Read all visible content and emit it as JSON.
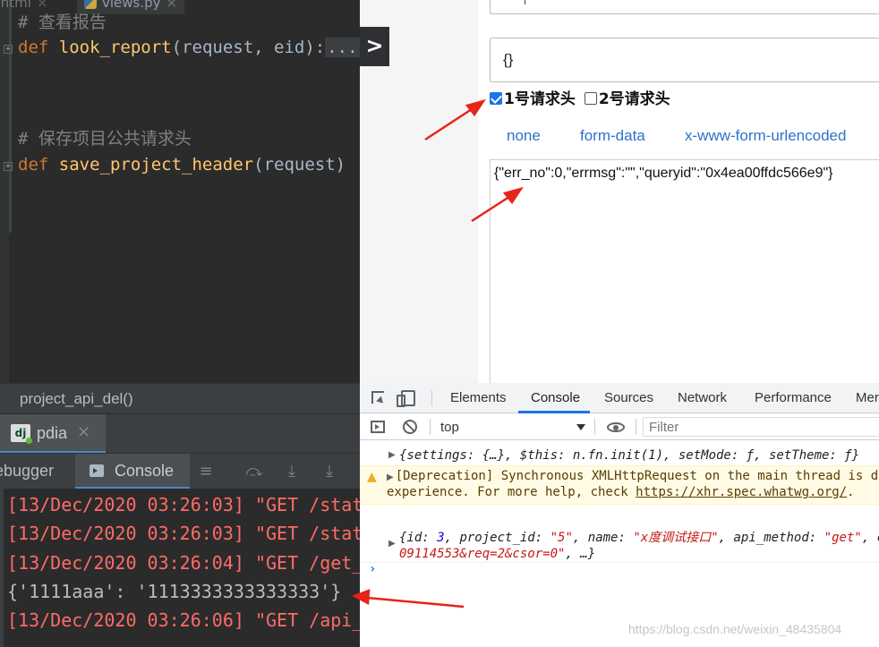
{
  "ide": {
    "tabs": [
      {
        "label": ".html",
        "close": "×"
      },
      {
        "label": "views.py",
        "close": "×"
      }
    ],
    "code": {
      "comment1": "# 查看报告",
      "kw": "def",
      "fn1": "look_report",
      "args1": "(request, eid):",
      "fold": "...",
      "comment2": "# 保存项目公共请求头",
      "fn2": "save_project_header",
      "args2": "(request)"
    },
    "breadcrumb": "project_api_del()",
    "run_tab": {
      "icon_text": "dj",
      "label": "pdia",
      "close": "×"
    },
    "tool_tabs": {
      "debugger": "ebugger",
      "console": "Console"
    },
    "console_lines": [
      {
        "text": "[13/Dec/2020 03:26:03] \"GET /stat",
        "kind": "err"
      },
      {
        "text": "[13/Dec/2020 03:26:03] \"GET /stat",
        "kind": "err"
      },
      {
        "text": "[13/Dec/2020 03:26:04] \"GET /get_",
        "kind": "err"
      },
      {
        "text": "{'1111aaa': '1113333333333333'}",
        "kind": "plain"
      },
      {
        "text": "[13/Dec/2020 03:26:06] \"GET /api_",
        "kind": "err"
      }
    ]
  },
  "page": {
    "next_button": ">",
    "body_value": "{}",
    "checkbox1": {
      "label": "1号请求头",
      "checked": true
    },
    "checkbox2": {
      "label": "2号请求头",
      "checked": false
    },
    "body_types": [
      "none",
      "form-data",
      "x-www-form-urlencoded"
    ],
    "response": "{\"err_no\":0,\"errmsg\":\"\",\"queryid\":\"0x4ea00ffdc566e9\"}"
  },
  "devtools": {
    "tabs": [
      "Elements",
      "Console",
      "Sources",
      "Network",
      "Performance",
      "Mer"
    ],
    "active_tab": "Console",
    "context": "top",
    "filter_placeholder": "Filter",
    "log1": "{settings: {…}, $this: n.fn.init(1), setMode: ƒ, setTheme: ƒ}",
    "warn_line1": "[Deprecation] Synchronous XMLHttpRequest on the main thread is dep",
    "warn_line2_pre": "experience. For more help, check ",
    "warn_link": "https://xhr.spec.whatwg.org/",
    "warn_line2_post": ".",
    "log3": {
      "p1": "{id: ",
      "id": "3",
      "p2": ", project_id: ",
      "project_id": "\"5\"",
      "p3": ", name: ",
      "name": "\"x度调试接口\"",
      "p4": ", api_method: ",
      "api_method": "\"get\"",
      "p5": ", c",
      "line2_str": "09114553&req=2&csor=0\"",
      "line2_tail": ", …}"
    },
    "prompt": "›"
  },
  "watermark": "https://blog.csdn.net/weixin_48435804",
  "colors": {
    "accent_blue": "#1a73e8",
    "arrow_red": "#e8231a",
    "console_error": "#ff6b68",
    "keyword": "#cc7832",
    "function": "#ffc66d"
  }
}
